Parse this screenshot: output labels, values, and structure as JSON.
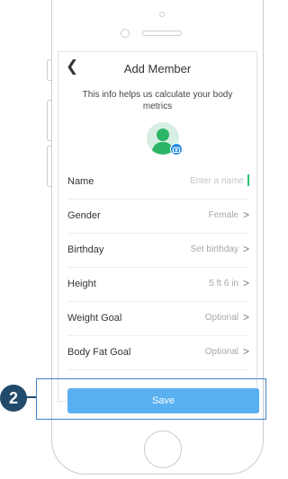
{
  "nav": {
    "back_icon": "chevron-left-icon",
    "title": "Add Member"
  },
  "info_text": "This info helps us calculate your body metrics",
  "avatar": {
    "icon": "person-avatar-icon",
    "badge_icon": "camera-icon"
  },
  "rows": [
    {
      "label": "Name",
      "placeholder": "Enter a name"
    },
    {
      "label": "Gender",
      "value": "Female"
    },
    {
      "label": "Birthday",
      "value": "Set birthday"
    },
    {
      "label": "Height",
      "value": "5 ft 6 in"
    },
    {
      "label": "Weight Goal",
      "value": "Optional"
    },
    {
      "label": "Body Fat Goal",
      "value": "Optional"
    }
  ],
  "chevron": ">",
  "save_label": "Save",
  "step_number": "2",
  "colors": {
    "save_button": "#58b0f0",
    "step_badge": "#214a6b",
    "avatar_green": "#2cb566",
    "camera_badge": "#2f8fe5",
    "cursor": "#2cc36b"
  }
}
